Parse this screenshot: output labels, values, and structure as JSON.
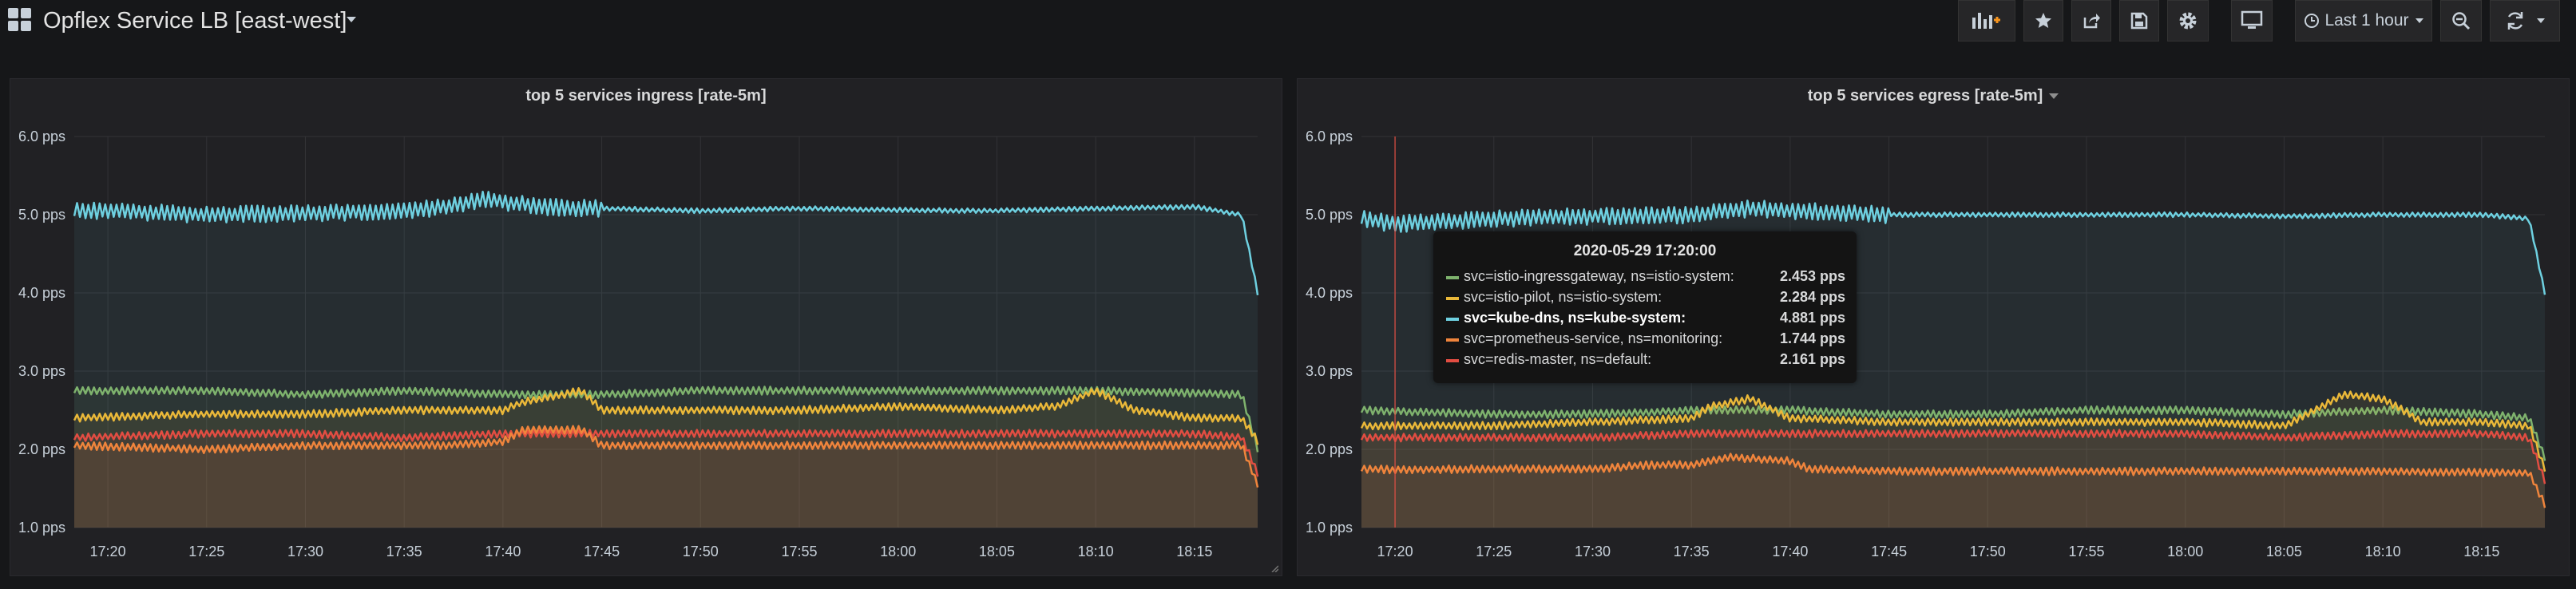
{
  "dashboard": {
    "title": "Opflex Service LB [east-west]"
  },
  "toolbar": {
    "time_range_label": "Last 1 hour"
  },
  "panels": [
    {
      "title": "top 5 services ingress [rate-5m]"
    },
    {
      "title": "top 5 services egress [rate-5m]"
    }
  ],
  "tooltip": {
    "time": "2020-05-29 17:20:00",
    "rows": [
      {
        "name": "svc=istio-ingressgateway, ns=istio-system:",
        "value": "2.453 pps",
        "color": "#7eb26d"
      },
      {
        "name": "svc=istio-pilot, ns=istio-system:",
        "value": "2.284 pps",
        "color": "#eab839"
      },
      {
        "name": "svc=kube-dns, ns=kube-system:",
        "value": "4.881 pps",
        "color": "#6ed0e0",
        "highlight": true
      },
      {
        "name": "svc=prometheus-service, ns=monitoring:",
        "value": "1.744 pps",
        "color": "#ef843c"
      },
      {
        "name": "svc=redis-master, ns=default:",
        "value": "2.161 pps",
        "color": "#e24d42"
      }
    ]
  },
  "chart_data": [
    {
      "type": "line",
      "title": "top 5 services ingress [rate-5m]",
      "y_ticks": [
        "1.0 pps",
        "2.0 pps",
        "3.0 pps",
        "4.0 pps",
        "5.0 pps",
        "6.0 pps"
      ],
      "x_ticks": [
        "17:20",
        "17:25",
        "17:30",
        "17:35",
        "17:40",
        "17:45",
        "17:50",
        "17:55",
        "18:00",
        "18:05",
        "18:10",
        "18:15"
      ],
      "ylim": [
        1,
        6
      ],
      "xlim_minutes": [
        -1.7,
        58.2
      ],
      "grid": true,
      "series": [
        {
          "color": "#6ed0e0",
          "x": [
            -1.7,
            0,
            5,
            10,
            15,
            17,
            19,
            22,
            25,
            30,
            35,
            40,
            45,
            50,
            55,
            57.4,
            58.2
          ],
          "y": [
            5.05,
            5.05,
            5.0,
            5.02,
            5.05,
            5.1,
            5.2,
            5.1,
            5.08,
            5.05,
            5.08,
            5.06,
            5.05,
            5.08,
            5.1,
            5.0,
            4.0
          ]
        },
        {
          "color": "#7eb26d",
          "x": [
            -1.7,
            5,
            10,
            15,
            20,
            25,
            30,
            35,
            40,
            45,
            50,
            55,
            57.4,
            58.2
          ],
          "y": [
            2.75,
            2.75,
            2.7,
            2.75,
            2.7,
            2.7,
            2.75,
            2.75,
            2.75,
            2.75,
            2.75,
            2.72,
            2.7,
            2.0
          ]
        },
        {
          "color": "#eab839",
          "x": [
            -1.7,
            5,
            10,
            15,
            20,
            21,
            24,
            25,
            30,
            35,
            40,
            45,
            48,
            50,
            52,
            55,
            57.4,
            58.2
          ],
          "y": [
            2.4,
            2.45,
            2.45,
            2.5,
            2.5,
            2.6,
            2.75,
            2.5,
            2.5,
            2.5,
            2.55,
            2.5,
            2.55,
            2.75,
            2.5,
            2.4,
            2.4,
            2.1
          ]
        },
        {
          "color": "#e24d42",
          "x": [
            -1.7,
            5,
            10,
            15,
            20,
            25,
            30,
            35,
            40,
            45,
            50,
            55,
            57.4,
            58.2
          ],
          "y": [
            2.15,
            2.2,
            2.2,
            2.15,
            2.2,
            2.2,
            2.2,
            2.2,
            2.2,
            2.2,
            2.2,
            2.2,
            2.15,
            1.7
          ]
        },
        {
          "color": "#ef843c",
          "x": [
            -1.7,
            5,
            10,
            15,
            17,
            20,
            21,
            24,
            25,
            30,
            35,
            40,
            45,
            50,
            55,
            57.4,
            58.2
          ],
          "y": [
            2.05,
            2.0,
            2.05,
            2.05,
            2.05,
            2.1,
            2.25,
            2.25,
            2.05,
            2.05,
            2.05,
            2.05,
            2.05,
            2.05,
            2.05,
            2.05,
            1.55
          ]
        }
      ]
    },
    {
      "type": "line",
      "title": "top 5 services egress [rate-5m]",
      "y_ticks": [
        "1.0 pps",
        "2.0 pps",
        "3.0 pps",
        "4.0 pps",
        "5.0 pps",
        "6.0 pps"
      ],
      "x_ticks": [
        "17:20",
        "17:25",
        "17:30",
        "17:35",
        "17:40",
        "17:45",
        "17:50",
        "17:55",
        "18:00",
        "18:05",
        "18:10",
        "18:15"
      ],
      "ylim": [
        1,
        6
      ],
      "xlim_minutes": [
        -1.7,
        58.2
      ],
      "grid": true,
      "crosshair_minutes": 0,
      "series": [
        {
          "name": "svc=kube-dns, ns=kube-system",
          "color": "#6ed0e0",
          "x": [
            -1.7,
            0,
            5,
            10,
            15,
            18,
            20,
            25,
            30,
            35,
            40,
            45,
            50,
            55,
            57.4,
            58.2
          ],
          "y": [
            4.95,
            4.88,
            4.95,
            4.98,
            5.0,
            5.08,
            5.05,
            5.0,
            5.0,
            5.0,
            5.0,
            4.98,
            5.0,
            5.0,
            4.95,
            4.0
          ]
        },
        {
          "name": "svc=istio-ingressgateway, ns=istio-system",
          "color": "#7eb26d",
          "x": [
            -1.7,
            5,
            10,
            15,
            20,
            25,
            30,
            35,
            40,
            45,
            50,
            55,
            57.4,
            58.2
          ],
          "y": [
            2.5,
            2.45,
            2.45,
            2.5,
            2.5,
            2.45,
            2.45,
            2.5,
            2.5,
            2.45,
            2.5,
            2.45,
            2.4,
            1.9
          ]
        },
        {
          "name": "svc=istio-pilot, ns=istio-system",
          "color": "#eab839",
          "x": [
            -1.7,
            5,
            10,
            15,
            16,
            18,
            20,
            25,
            30,
            35,
            40,
            45,
            48,
            50,
            52,
            55,
            57.4,
            58.2
          ],
          "y": [
            2.3,
            2.3,
            2.35,
            2.4,
            2.55,
            2.65,
            2.4,
            2.35,
            2.35,
            2.35,
            2.35,
            2.3,
            2.7,
            2.65,
            2.35,
            2.35,
            2.3,
            1.75
          ]
        },
        {
          "name": "svc=redis-master, ns=default",
          "color": "#e24d42",
          "x": [
            -1.7,
            5,
            10,
            15,
            20,
            25,
            30,
            35,
            40,
            45,
            50,
            55,
            57.4,
            58.2
          ],
          "y": [
            2.15,
            2.15,
            2.15,
            2.2,
            2.2,
            2.2,
            2.2,
            2.2,
            2.2,
            2.15,
            2.2,
            2.2,
            2.15,
            1.6
          ]
        },
        {
          "name": "svc=prometheus-service, ns=monitoring",
          "color": "#ef843c",
          "x": [
            -1.7,
            0,
            5,
            10,
            13,
            15,
            17,
            20,
            21,
            25,
            30,
            35,
            40,
            45,
            50,
            55,
            57.4,
            58.2
          ],
          "y": [
            1.75,
            1.74,
            1.75,
            1.75,
            1.8,
            1.8,
            1.9,
            1.85,
            1.75,
            1.72,
            1.72,
            1.72,
            1.72,
            1.72,
            1.72,
            1.7,
            1.7,
            1.3
          ]
        }
      ]
    }
  ]
}
